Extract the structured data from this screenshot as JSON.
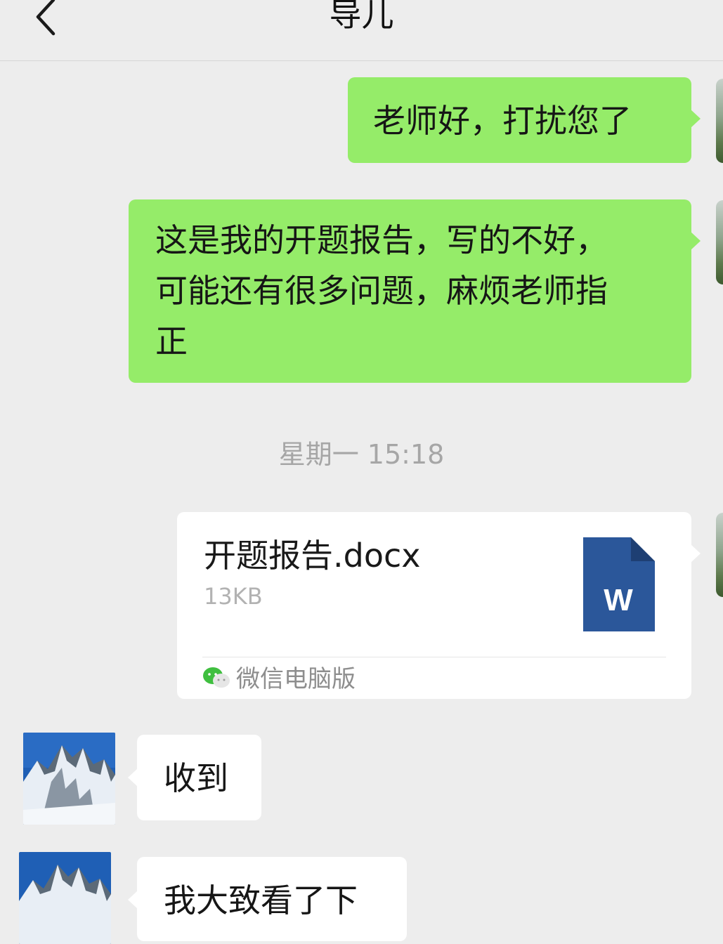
{
  "header": {
    "back_icon": "chevron-left-icon",
    "title": "导儿"
  },
  "messages": [
    {
      "from": "me",
      "text": "老师好，打扰您了"
    },
    {
      "from": "me",
      "lines": [
        "这是我的开题报告，写的不好，",
        "可能还有很多问题，麻烦老师指",
        "正"
      ]
    },
    {
      "from": "her",
      "text": "收到"
    },
    {
      "from": "her",
      "text": "我大致看了下"
    }
  ],
  "timestamp": "星期一 15:18",
  "file": {
    "name": "开题报告.docx",
    "size": "13KB",
    "icon": "word-document-icon",
    "icon_letter": "W",
    "source": "微信电脑版",
    "source_icon": "wechat-icon"
  },
  "colors": {
    "outgoing_bubble": "#95ec69",
    "incoming_bubble": "#ffffff",
    "background": "#ededed",
    "word_blue": "#2b579a"
  }
}
